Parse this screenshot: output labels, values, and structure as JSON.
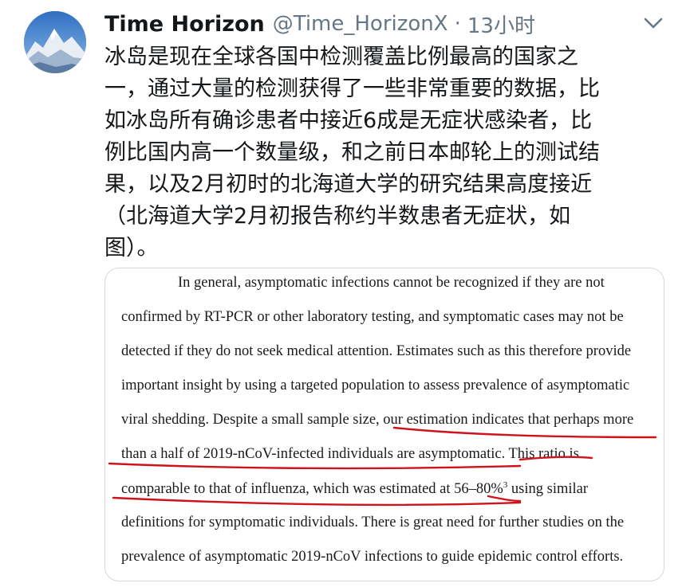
{
  "tweet": {
    "author": {
      "display_name": "Time Horizon",
      "handle": "@Time_HorizonX",
      "separator": "·",
      "timestamp": "13小时",
      "avatar_icon": "snowy-mountain-avatar"
    },
    "menu_icon": "chevron-down-icon",
    "text": "冰岛是现在全球各国中检测覆盖比例最高的国家之\n一，通过大量的检测获得了一些非常重要的数据，比\n如冰岛所有确诊患者中接近6成是无症状感染者，比\n例比国内高一个数量级，和之前日本邮轮上的测试结\n果，以及2月初时的北海道大学的研究结果高度接近\n（北海道大学2月初报告称约半数患者无症状，如\n图）。",
    "image": {
      "lines": [
        "In general, asymptomatic infections cannot be recognized if they are not",
        "confirmed by RT-PCR or other laboratory testing, and symptomatic cases may not be",
        "detected if they do not seek medical attention. Estimates such as this therefore provide",
        "important insight by using a targeted population to assess prevalence of asymptomatic",
        "viral shedding. Despite a small sample size, our estimation indicates that perhaps more",
        "than a half of 2019-nCoV-infected individuals are asymptomatic. This ratio is",
        "comparable to that of influenza, which was estimated at 56–80%",
        "definitions for symptomatic individuals. There is great need for further studies on the",
        "prevalence of asymptomatic 2019-nCoV infections to guide epidemic control efforts."
      ],
      "citation_superscript": "3",
      "line7_tail": " using similar",
      "annotation_color": "#d0131b"
    }
  }
}
